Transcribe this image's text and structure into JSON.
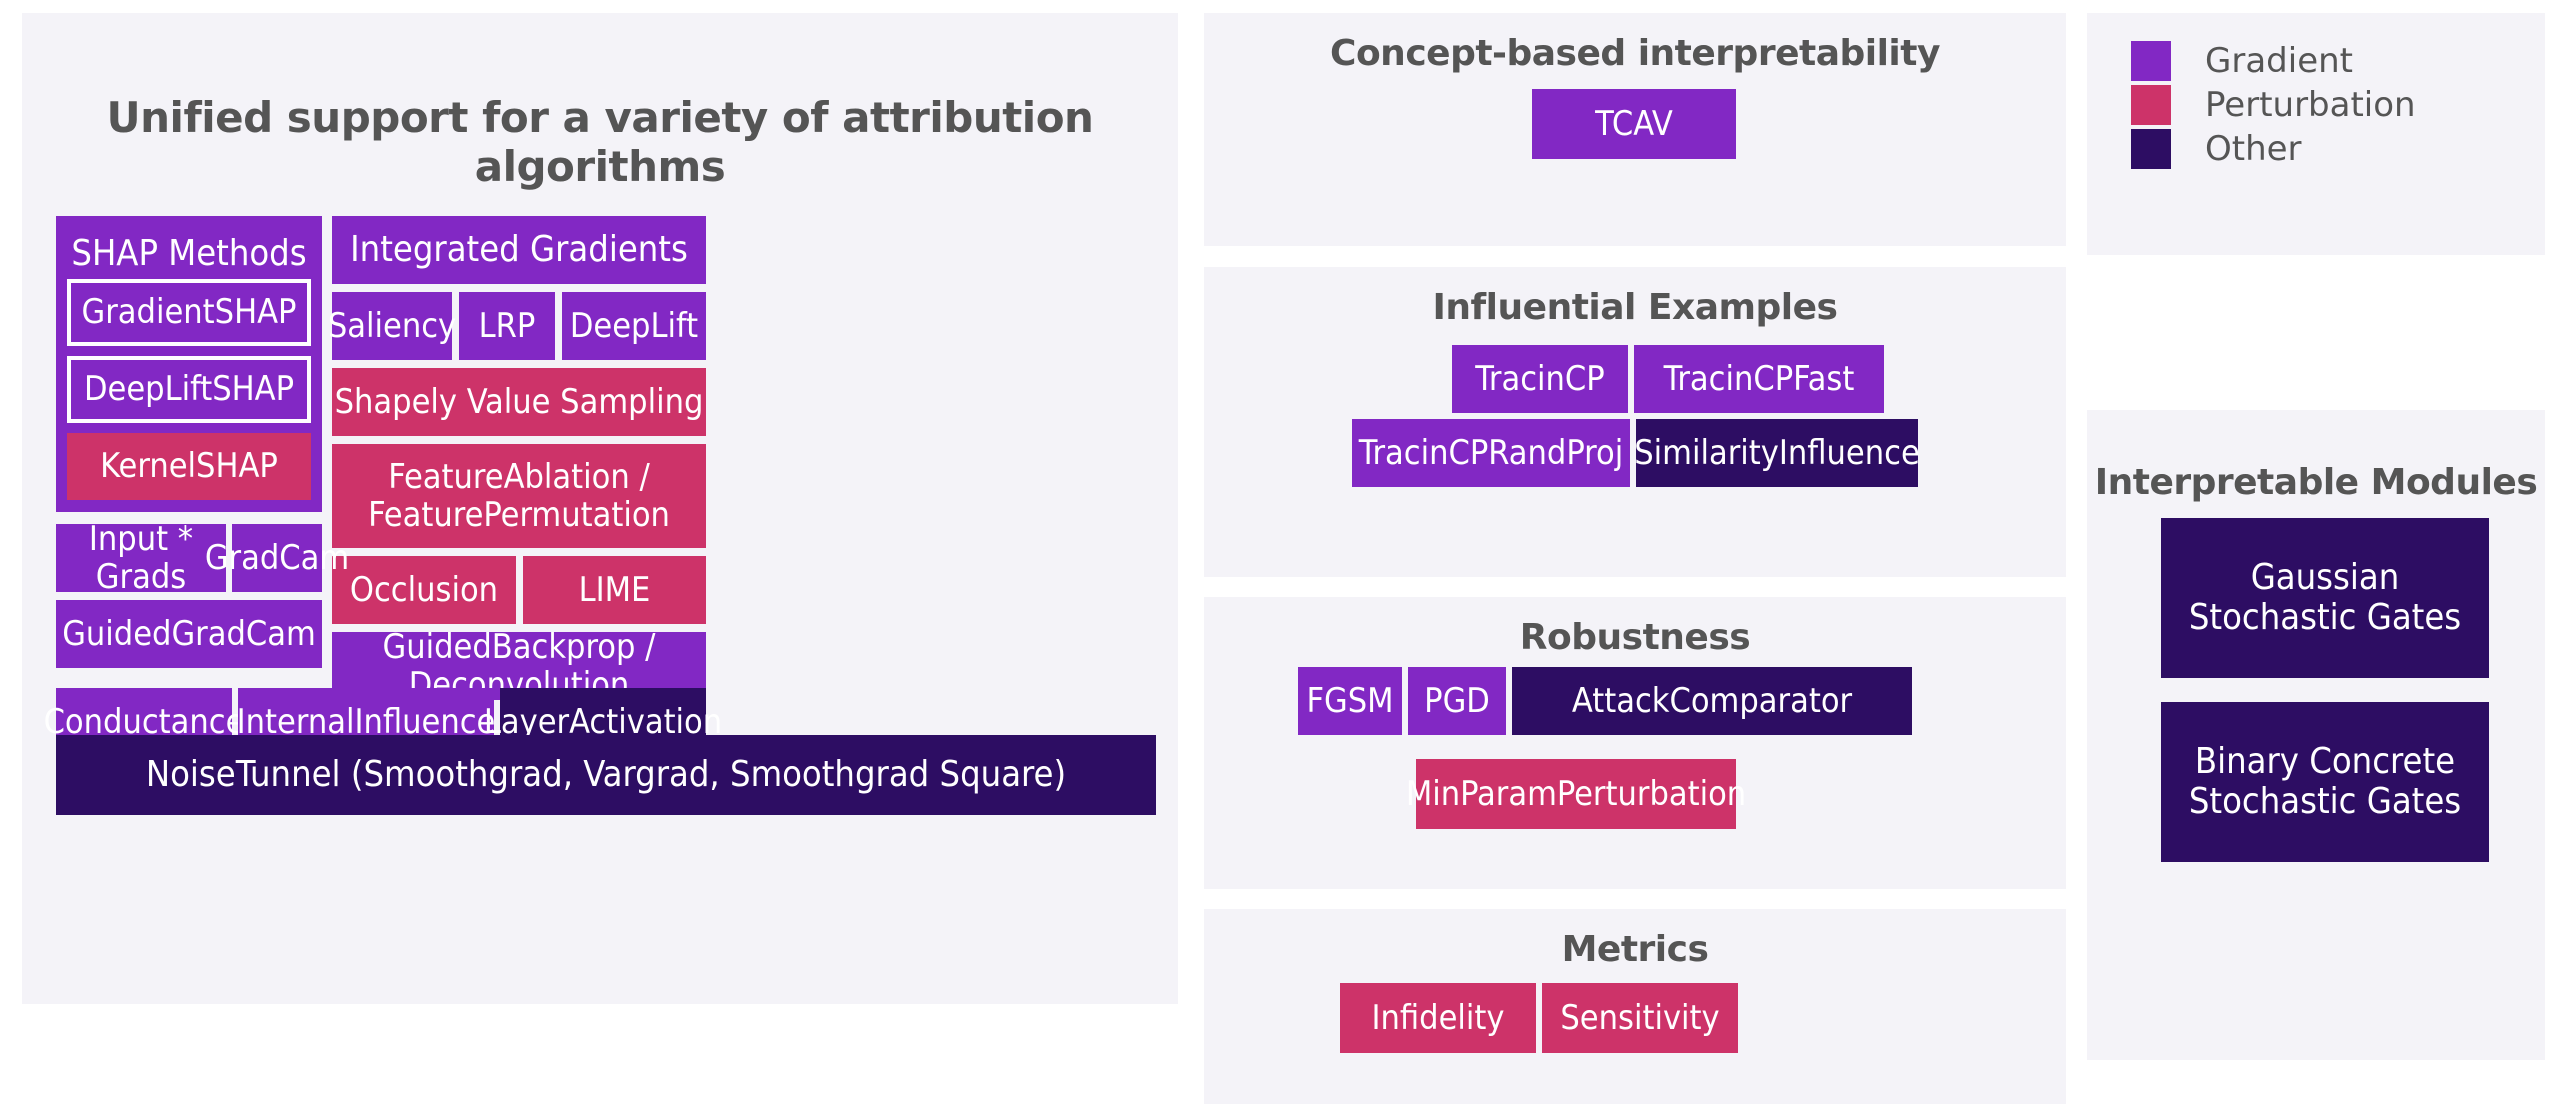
{
  "colors": {
    "gradient": "#8228c4",
    "perturbation": "#cd3369",
    "other": "#2d0d63",
    "panel_background": "#f4f3f8",
    "page_background": "#ffffff",
    "title_text": "#555555",
    "box_text": "#ffffff"
  },
  "left_panel": {
    "title": "Unified support for a variety of attribution algorithms",
    "shap_group": {
      "heading": "SHAP Methods",
      "items": [
        {
          "label": "GradientSHAP",
          "category": "gradient",
          "outlined": true
        },
        {
          "label": "DeepLiftSHAP",
          "category": "gradient",
          "outlined": true
        },
        {
          "label": "KernelSHAP",
          "category": "perturbation",
          "outlined": false
        }
      ]
    },
    "boxes": [
      {
        "label": "Integrated Gradients",
        "category": "gradient"
      },
      {
        "label": "Saliency",
        "category": "gradient"
      },
      {
        "label": "LRP",
        "category": "gradient"
      },
      {
        "label": "DeepLift",
        "category": "gradient"
      },
      {
        "label": "Shapely Value Sampling",
        "category": "perturbation"
      },
      {
        "label": "FeatureAblation /\nFeaturePermutation",
        "category": "perturbation"
      },
      {
        "label": "Occlusion",
        "category": "perturbation"
      },
      {
        "label": "LIME",
        "category": "perturbation"
      },
      {
        "label": "Input * Grads",
        "category": "gradient"
      },
      {
        "label": "GradCam",
        "category": "gradient"
      },
      {
        "label": "GuidedGradCam",
        "category": "gradient"
      },
      {
        "label": "GuidedBackprop / Deconvolution",
        "category": "gradient"
      },
      {
        "label": "Conductance",
        "category": "gradient"
      },
      {
        "label": "InternalInfluence",
        "category": "gradient"
      },
      {
        "label": "LayerActivation",
        "category": "other"
      }
    ],
    "noise_tunnel": {
      "label": "NoiseTunnel (Smoothgrad, Vargrad, Smoothgrad Square)",
      "category": "other"
    }
  },
  "middle_column": {
    "concept": {
      "title": "Concept-based interpretability",
      "boxes": [
        {
          "label": "TCAV",
          "category": "gradient"
        }
      ]
    },
    "influential": {
      "title": "Influential Examples",
      "boxes": [
        {
          "label": "TracinCP",
          "category": "gradient"
        },
        {
          "label": "TracinCPFast",
          "category": "gradient"
        },
        {
          "label": "TracinCPRandProj",
          "category": "gradient"
        },
        {
          "label": "SimilarityInfluence",
          "category": "other"
        }
      ]
    },
    "robustness": {
      "title": "Robustness",
      "boxes": [
        {
          "label": "FGSM",
          "category": "gradient"
        },
        {
          "label": "PGD",
          "category": "gradient"
        },
        {
          "label": "AttackComparator",
          "category": "other"
        },
        {
          "label": "MinParamPerturbation",
          "category": "perturbation"
        }
      ]
    },
    "metrics": {
      "title": "Metrics",
      "boxes": [
        {
          "label": "Infidelity",
          "category": "perturbation"
        },
        {
          "label": "Sensitivity",
          "category": "perturbation"
        }
      ]
    }
  },
  "right_column": {
    "legend": {
      "items": [
        {
          "label": "Gradient",
          "color": "#8228c4"
        },
        {
          "label": "Perturbation",
          "color": "#cd3369"
        },
        {
          "label": "Other",
          "color": "#2d0d63"
        }
      ]
    },
    "modules": {
      "title": "Interpretable Modules",
      "boxes": [
        {
          "label": "Gaussian\nStochastic Gates",
          "category": "other"
        },
        {
          "label": "Binary Concrete\nStochastic Gates",
          "category": "other"
        }
      ]
    }
  }
}
